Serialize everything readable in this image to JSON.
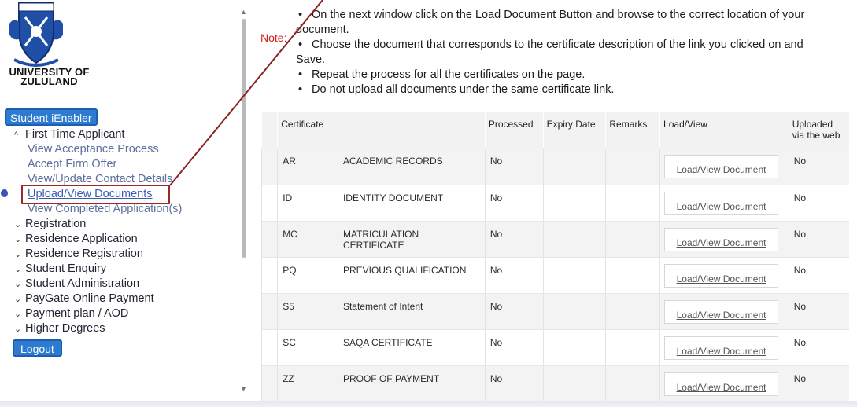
{
  "brand": {
    "name_line1": "UNIVERSITY OF",
    "name_line2": "ZULULAND",
    "logo_icon": "university-crest-icon",
    "colors": {
      "blue": "#1f4fa6",
      "highlight": "#9a2a2a",
      "note_red": "#d02020"
    }
  },
  "sidebar": {
    "ienabler_label": "Student iEnabler",
    "sections": [
      {
        "label": "First Time Applicant",
        "expanded": true
      },
      {
        "label": "Registration",
        "expanded": false
      },
      {
        "label": "Residence Application",
        "expanded": false
      },
      {
        "label": "Residence Registration",
        "expanded": false
      },
      {
        "label": "Student Enquiry",
        "expanded": false
      },
      {
        "label": "Student Administration",
        "expanded": false
      },
      {
        "label": "PayGate Online Payment",
        "expanded": false
      },
      {
        "label": "Payment plan / AOD",
        "expanded": false
      },
      {
        "label": "Higher Degrees",
        "expanded": false
      }
    ],
    "sub_items": [
      {
        "label": "View Acceptance Process"
      },
      {
        "label": "Accept Firm Offer"
      },
      {
        "label": "View/Update Contact Details"
      },
      {
        "label": "Upload/View Documents",
        "active": true
      },
      {
        "label": "View Completed Application(s)"
      }
    ],
    "logout_label": "Logout"
  },
  "main": {
    "note_label": "Note:",
    "instructions": {
      "b1_l1": "On the next window click on the Load Document Button and browse to the correct location of your",
      "b1_l2": "document.",
      "b2_l1": "Choose the document that corresponds to the certificate description of the link you clicked on and",
      "b2_l2": "Save.",
      "b3": "Repeat the process for all the certificates on the page.",
      "b4": "Do not upload all documents under the same certificate link."
    },
    "table": {
      "headers": {
        "certificate": "Certificate",
        "processed": "Processed",
        "expiry": "Expiry Date",
        "remarks": "Remarks",
        "load": "Load/View",
        "uploaded": "Uploaded via the web"
      },
      "load_button_label": "Load/View Document",
      "rows": [
        {
          "code": "AR",
          "description": "ACADEMIC RECORDS",
          "processed": "No",
          "expiry": "",
          "remarks": "",
          "uploaded": "No"
        },
        {
          "code": "ID",
          "description": "IDENTITY DOCUMENT",
          "processed": "No",
          "expiry": "",
          "remarks": "",
          "uploaded": "No"
        },
        {
          "code": "MC",
          "description": "MATRICULATION CERTIFICATE",
          "processed": "No",
          "expiry": "",
          "remarks": "",
          "uploaded": "No"
        },
        {
          "code": "PQ",
          "description": "PREVIOUS QUALIFICATION",
          "processed": "No",
          "expiry": "",
          "remarks": "",
          "uploaded": "No"
        },
        {
          "code": "S5",
          "description": "Statement of Intent",
          "processed": "No",
          "expiry": "",
          "remarks": "",
          "uploaded": "No"
        },
        {
          "code": "SC",
          "description": "SAQA CERTIFICATE",
          "processed": "No",
          "expiry": "",
          "remarks": "",
          "uploaded": "No"
        },
        {
          "code": "ZZ",
          "description": "PROOF OF PAYMENT",
          "processed": "No",
          "expiry": "",
          "remarks": "",
          "uploaded": "No"
        }
      ]
    }
  }
}
